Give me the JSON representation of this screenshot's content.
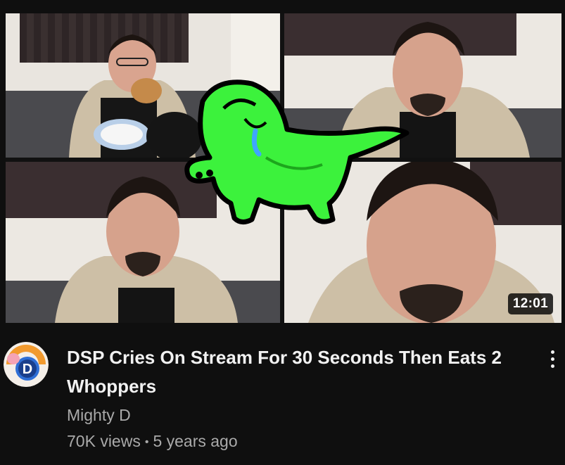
{
  "video": {
    "duration": "12:01",
    "title": "DSP Cries On Stream For 30 Seconds Then Eats 2 Whoppers",
    "channel": "Mighty D",
    "views": "70K views",
    "separator": "•",
    "age": "5 years ago"
  },
  "avatar": {
    "letter": "D",
    "colors": {
      "ring": "#f29a2e",
      "inner": "#2f6fd6",
      "pig": "#f4a3b5"
    }
  },
  "icons": {
    "menu": "more-vert-icon",
    "mascot": "crying-alligator-icon"
  },
  "theme": {
    "background": "#0f0f0f",
    "title_color": "#f1f1f1",
    "secondary_color": "#aaaaaa",
    "mascot_green": "#3cf23c"
  }
}
